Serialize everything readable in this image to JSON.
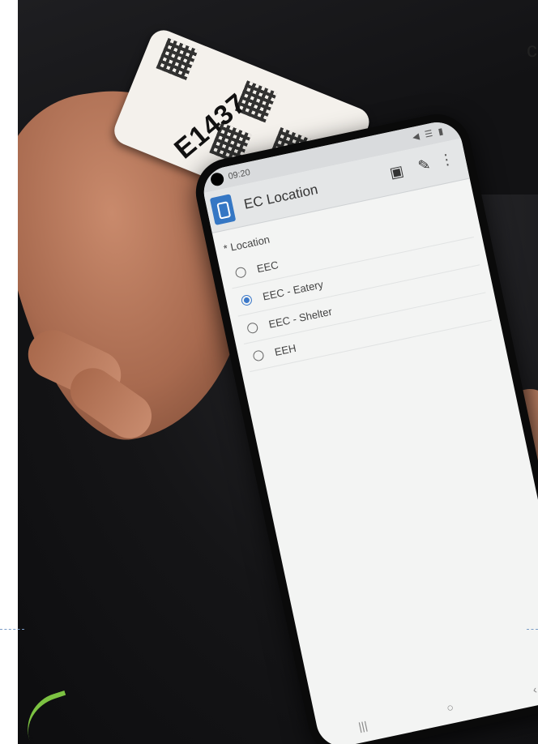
{
  "wristband": {
    "code": "E1437"
  },
  "page_edge_text": "c",
  "phone": {
    "status_time": "09:20",
    "status_icons": "◀ ☰ ▮",
    "app_title": "EC Location",
    "field": {
      "label": "* Location",
      "options": [
        {
          "label": "EEC",
          "checked": false
        },
        {
          "label": "EEC - Eatery",
          "checked": true
        },
        {
          "label": "EEC - Shelter",
          "checked": false
        },
        {
          "label": "EEH",
          "checked": false
        }
      ]
    },
    "icons": {
      "logo": "app-logo-icon",
      "save": "save-icon",
      "edit": "pen-icon",
      "menu": "more-vert-icon"
    },
    "nav": {
      "recent": "|||",
      "home": "○",
      "back": "‹"
    }
  },
  "colors": {
    "accent": "#3b78c9",
    "swoosh": "#7cc242"
  }
}
